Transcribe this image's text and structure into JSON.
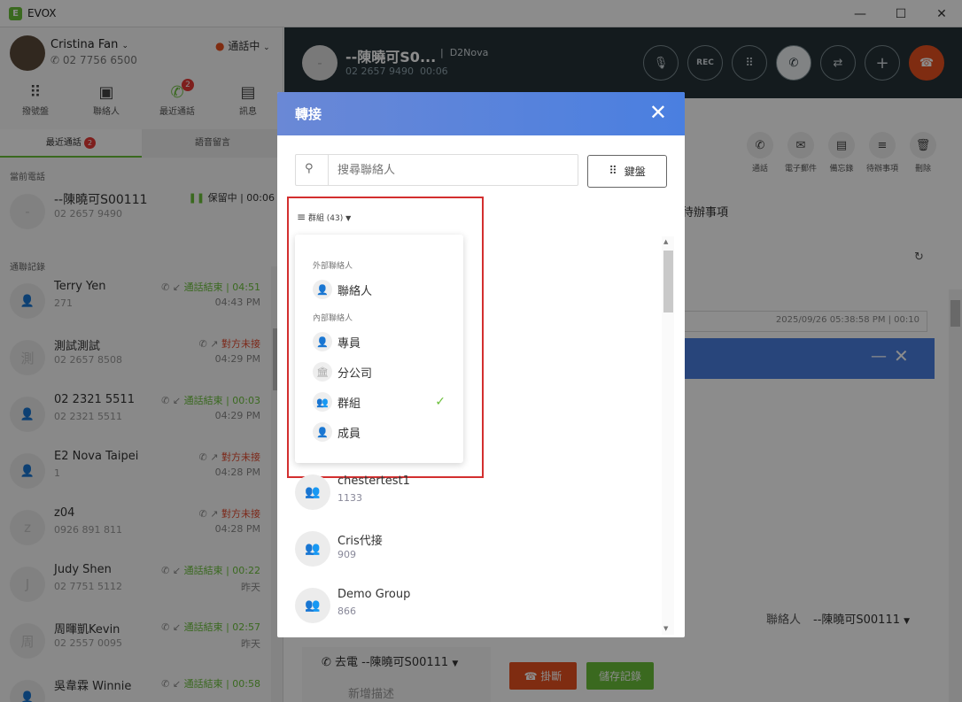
{
  "window": {
    "title": "EVOX",
    "logo": "E"
  },
  "user": {
    "name": "Cristina Fan",
    "phone": "02 7756 6500",
    "status": "通話中"
  },
  "nav_tabs": [
    {
      "label": "撥號盤",
      "icon": "dialpad-icon"
    },
    {
      "label": "聯絡人",
      "icon": "contact-card-icon"
    },
    {
      "label": "最近通話",
      "icon": "phone-icon",
      "badge": "2"
    },
    {
      "label": "訊息",
      "icon": "message-icon"
    }
  ],
  "sub_tabs": {
    "recent": "最近通話",
    "recent_badge": "2",
    "voicemail": "語音留言"
  },
  "current_call_section": "當前電話",
  "current_call": {
    "avatar": "-",
    "name": "--陳曉可S00111",
    "number": "02 2657 9490",
    "status": "保留中 | 00:06"
  },
  "history_section": "通聯記錄",
  "history": [
    {
      "avatar": "",
      "name": "Terry Yen",
      "number": "271",
      "status": "通話結束 | 04:51",
      "time": "04:43 PM",
      "missed": false
    },
    {
      "avatar": "測",
      "name": "測試測試",
      "number": "02 2657 8508",
      "status": "對方未接",
      "time": "04:29 PM",
      "missed": true
    },
    {
      "avatar": "",
      "name": "02 2321 5511",
      "number": "02 2321 5511",
      "status": "通話結束 | 00:03",
      "time": "04:29 PM",
      "missed": false
    },
    {
      "avatar": "",
      "name": "E2 Nova Taipei",
      "number": "1",
      "status": "對方未接",
      "time": "04:28 PM",
      "missed": true
    },
    {
      "avatar": "z",
      "name": "z04",
      "number": "0926 891 811",
      "status": "對方未接",
      "time": "04:28 PM",
      "missed": true
    },
    {
      "avatar": "J",
      "name": "Judy Shen",
      "number": "02 7751 5112",
      "status": "通話結束 | 00:22",
      "time": "昨天",
      "missed": false
    },
    {
      "avatar": "周",
      "name": "周暉凱Kevin",
      "number": "02 2557 0095",
      "status": "通話結束 | 02:57",
      "time": "昨天",
      "missed": false
    },
    {
      "avatar": "",
      "name": "吳韋霖 Winnie",
      "number": "",
      "status": "通話結束 | 00:58",
      "time": "",
      "missed": false
    }
  ],
  "call_header": {
    "name": "--陳曉可S0...",
    "company": "D2Nova",
    "number": "02 2657 9490",
    "duration": "00:06"
  },
  "call_buttons": {
    "rec": "REC"
  },
  "actions": [
    "通話",
    "電子郵件",
    "備忘錄",
    "待辦事項",
    "刪除"
  ],
  "right_tab": "待辦事項",
  "right_meta": {
    "contact_label": "聯絡人",
    "contact_value": "--陳曉可S00111",
    "timestamp": "2025/09/26 05:38:58 PM | 00:10"
  },
  "bottom": {
    "call_title": "去電 --陳曉可S00111",
    "add_desc": "新增描述",
    "hangup": "掛斷",
    "save": "儲存記錄"
  },
  "modal": {
    "title": "轉接",
    "search_placeholder": "搜尋聯絡人",
    "keypad": "鍵盤",
    "filter_label": "群組 (43)",
    "dropdown": {
      "external_header": "外部聯絡人",
      "external_item": "聯絡人",
      "internal_header": "內部聯絡人",
      "items": [
        "專員",
        "分公司",
        "群組",
        "成員"
      ],
      "selected": "群組"
    },
    "list": [
      {
        "name": "chestertest1",
        "ext": "1133"
      },
      {
        "name": "Cris代接",
        "ext": "909"
      },
      {
        "name": "Demo Group",
        "ext": "866"
      }
    ]
  },
  "colors": {
    "accent_green": "#6abf3a",
    "missed_red": "#e24a2e",
    "hangup_orange": "#e8501f",
    "modal_blue": "#4a7fe0",
    "highlight_red": "#d32f2f"
  }
}
